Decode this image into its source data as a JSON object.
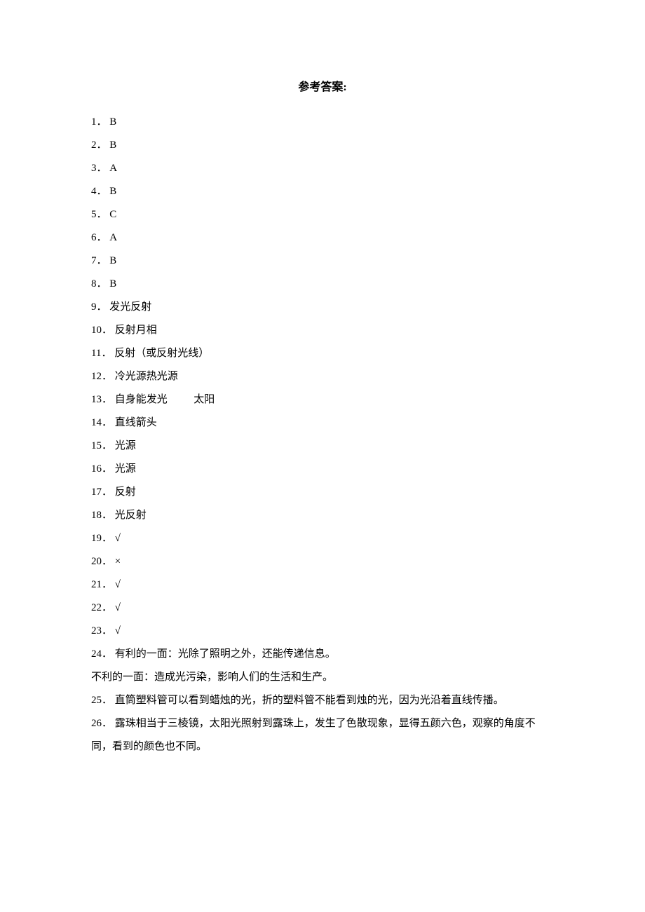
{
  "title": "参考答案:",
  "items": [
    {
      "num": "1．",
      "ans": "B"
    },
    {
      "num": "2．",
      "ans": "B"
    },
    {
      "num": "3．",
      "ans": "A"
    },
    {
      "num": "4．",
      "ans": "B"
    },
    {
      "num": "5．",
      "ans": "C"
    },
    {
      "num": "6．",
      "ans": "A"
    },
    {
      "num": "7．",
      "ans": "B"
    },
    {
      "num": "8．",
      "ans": "B"
    },
    {
      "num": "9．",
      "ans": "发光反射"
    },
    {
      "num": "10．",
      "ans": "反射月相"
    },
    {
      "num": "11．",
      "ans": "反射（或反射光线）"
    },
    {
      "num": "12．",
      "ans": "冷光源热光源"
    },
    {
      "num": "13．",
      "ans": "自身能发光          太阳"
    },
    {
      "num": "14．",
      "ans": "直线箭头"
    },
    {
      "num": "15．",
      "ans": "光源"
    },
    {
      "num": "16．",
      "ans": "光源"
    },
    {
      "num": "17．",
      "ans": "反射"
    },
    {
      "num": "18．",
      "ans": "光反射"
    },
    {
      "num": "19．",
      "ans": "√"
    },
    {
      "num": "20．",
      "ans": "×"
    },
    {
      "num": "21．",
      "ans": "√"
    },
    {
      "num": "22．",
      "ans": "√"
    },
    {
      "num": "23．",
      "ans": "√"
    },
    {
      "num": "24．",
      "ans": "有利的一面：光除了照明之外，还能传递信息。"
    }
  ],
  "extra_lines": [
    "不利的一面：造成光污染，影响人们的生活和生产。",
    "25． 直筒塑料管可以看到蜡烛的光，折的塑料管不能看到烛的光，因为光沿着直线传播。",
    "26． 露珠相当于三棱镜，太阳光照射到露珠上，发生了色散现象，显得五颜六色，观察的角度不同，看到的颜色也不同。"
  ]
}
